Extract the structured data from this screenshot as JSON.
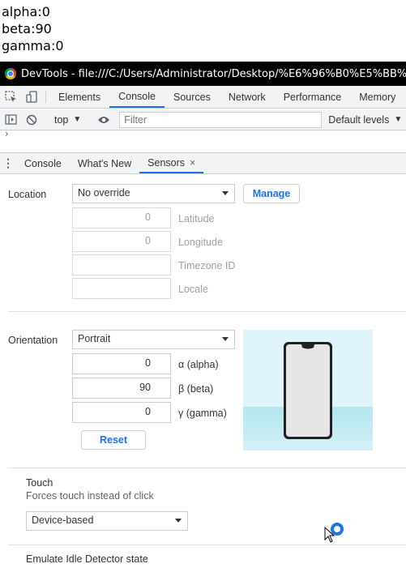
{
  "page_output": {
    "alpha": "alpha:0",
    "beta": "beta:90",
    "gamma": "gamma:0"
  },
  "window": {
    "title": "DevTools - file:///C:/Users/Administrator/Desktop/%E6%96%B0%E5%BB%BA%E6%"
  },
  "tabs": [
    {
      "label": "Elements"
    },
    {
      "label": "Console"
    },
    {
      "label": "Sources"
    },
    {
      "label": "Network"
    },
    {
      "label": "Performance"
    },
    {
      "label": "Memory"
    }
  ],
  "console_toolbar": {
    "context": "top",
    "filter_placeholder": "Filter",
    "levels": "Default levels"
  },
  "drawer": {
    "tabs": [
      {
        "label": "Console"
      },
      {
        "label": "What's New"
      },
      {
        "label": "Sensors"
      }
    ],
    "close_glyph": "×"
  },
  "sensors": {
    "location": {
      "label": "Location",
      "selected": "No override",
      "manage_label": "Manage",
      "latitude": {
        "value": "0",
        "label": "Latitude"
      },
      "longitude": {
        "value": "0",
        "label": "Longitude"
      },
      "timezone": {
        "value": "",
        "label": "Timezone ID"
      },
      "locale": {
        "value": "",
        "label": "Locale"
      }
    },
    "orientation": {
      "label": "Orientation",
      "selected": "Portrait",
      "alpha": {
        "value": "0",
        "label": "α (alpha)"
      },
      "beta": {
        "value": "90",
        "label": "β (beta)"
      },
      "gamma": {
        "value": "0",
        "label": "γ (gamma)"
      },
      "reset_label": "Reset"
    },
    "touch": {
      "title": "Touch",
      "description": "Forces touch instead of click",
      "selected": "Device-based"
    },
    "idle": {
      "title": "Emulate Idle Detector state"
    }
  },
  "colors": {
    "accent": "#1a73e8",
    "titlebar": "#000000"
  }
}
